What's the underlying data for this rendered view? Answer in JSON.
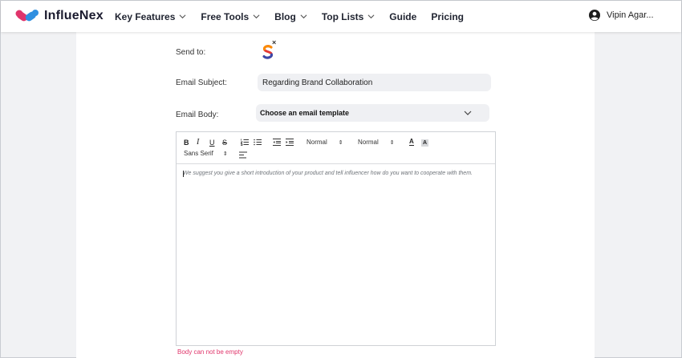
{
  "brand": {
    "name": "InflueNex"
  },
  "nav": {
    "items": [
      {
        "label": "Key Features",
        "dropdown": true
      },
      {
        "label": "Free Tools",
        "dropdown": true
      },
      {
        "label": "Blog",
        "dropdown": true
      },
      {
        "label": "Top Lists",
        "dropdown": true
      },
      {
        "label": "Guide",
        "dropdown": false
      },
      {
        "label": "Pricing",
        "dropdown": false
      }
    ],
    "user_name": "Vipin Agar..."
  },
  "form": {
    "send_to_label": "Send to:",
    "recipient_remove": "×",
    "subject_label": "Email Subject:",
    "subject_value": "Regarding Brand Collaboration",
    "body_label": "Email Body:",
    "template_select": "Choose an email template",
    "toolbar": {
      "bold": "B",
      "italic": "I",
      "underline": "U",
      "strike": "S",
      "size_picker": "Normal",
      "header_picker": "Normal",
      "font_picker": "Sans Serif",
      "picker_arrow": "⇕",
      "color_glyph": "A",
      "background_glyph": "A"
    },
    "body_placeholder": "We suggest you give a short introduction of your product and tell influencer how do you want to cooperate with them.",
    "error_message": "Body can not be empty"
  },
  "colors": {
    "brand_pink": "#e0356b",
    "brand_blue": "#2f6fd6",
    "page_bg": "#f1f2f4",
    "field_bg": "#eff0f3",
    "error": "#e0356b"
  }
}
